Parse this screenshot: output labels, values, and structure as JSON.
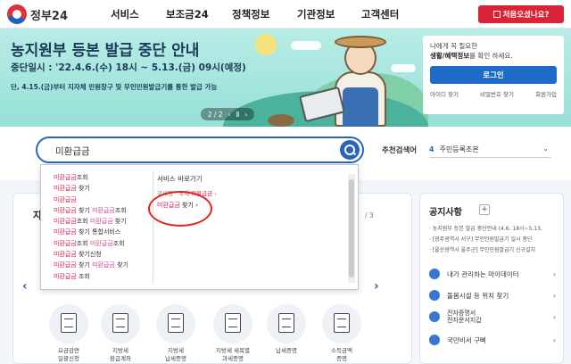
{
  "header": {
    "logo_text": "정부24",
    "nav": [
      "서비스",
      "보조금24",
      "정책정보",
      "기관정보",
      "고객센터"
    ],
    "cta_label": "처음오셨나요?",
    "colors": {
      "cta": "#d92336",
      "primary": "#2c64b6"
    }
  },
  "banner": {
    "title": "농지원부 등본 발급 중단 안내",
    "period": "중단일시 : '22.4.6.(수) 18시 ~ 5.13.(금) 09시(예정)",
    "note": "단, 4.15.(금)부터 지자체 민원창구 및 무인민원발급기를 통한 발급 가능",
    "pager": {
      "text": "2 / 2",
      "prev": "‹",
      "pause": "Ⅱ",
      "next": "›"
    }
  },
  "login": {
    "desc_line1": "나에게 꼭 필요한",
    "desc_line2_bold": "생활/혜택정보",
    "desc_line2_rest": "를 확인 하세요.",
    "button": "로그인",
    "links": [
      "아이디 찾기",
      "비밀번호 찾기",
      "회원가입"
    ]
  },
  "search": {
    "value": "미환급금",
    "recommend_label": "추천검색어",
    "recommend_num": "4",
    "recommend_term": "주민등록조본",
    "chevron": "⌄"
  },
  "autocomplete": {
    "items": [
      [
        {
          "t": "미환급금",
          "c": "red"
        },
        {
          "t": "조회",
          "c": ""
        }
      ],
      [
        {
          "t": "미환급금",
          "c": "red"
        },
        {
          "t": " 찾기",
          "c": ""
        }
      ],
      [
        {
          "t": "미환급금",
          "c": "red"
        }
      ],
      [
        {
          "t": "미환급금",
          "c": "red"
        },
        {
          "t": " 찾기 ",
          "c": ""
        },
        {
          "t": "미환급금",
          "c": "pink"
        },
        {
          "t": "조회",
          "c": ""
        }
      ],
      [
        {
          "t": "미환급금",
          "c": "red"
        },
        {
          "t": "조회 ",
          "c": ""
        },
        {
          "t": "미환급금",
          "c": "pink"
        },
        {
          "t": " 찾기",
          "c": ""
        }
      ],
      [
        {
          "t": "미환급금",
          "c": "red"
        },
        {
          "t": " 찾기 통합서비스",
          "c": ""
        }
      ],
      [
        {
          "t": "미환급금",
          "c": "red"
        },
        {
          "t": "조회 ",
          "c": ""
        },
        {
          "t": "미환급금",
          "c": "pink"
        },
        {
          "t": "조회",
          "c": ""
        }
      ],
      [
        {
          "t": "미환급금",
          "c": "red"
        },
        {
          "t": " 찾기신청",
          "c": ""
        }
      ],
      [
        {
          "t": "미환급금",
          "c": "red"
        },
        {
          "t": " 찾기 ",
          "c": ""
        },
        {
          "t": "미환급금",
          "c": "pink"
        },
        {
          "t": " 찾기",
          "c": ""
        }
      ],
      [
        {
          "t": "미환급금",
          "c": "red"
        },
        {
          "t": " 조회",
          "c": ""
        }
      ]
    ],
    "shortcut_title": "서비스 바로가기",
    "shortcut1_prefix": "국세청 · 국세",
    "shortcut1_red": "미환급금",
    "shortcut1_chev": "›",
    "shortcut2_red": "미환급금",
    "shortcut2_rest": " 찾기",
    "shortcut2_chev": "›"
  },
  "services": {
    "title": "자",
    "page": "/ 3",
    "prev": "‹",
    "next": "›",
    "tiles": [
      {
        "l1": "요금감면",
        "l2": "일괄신청"
      },
      {
        "l1": "지방세",
        "l2": "환급계좌"
      },
      {
        "l1": "지방세",
        "l2": "납세증명"
      },
      {
        "l1": "지방세 세목별",
        "l2": "과세증명"
      },
      {
        "l1": "납세증명",
        "l2": ""
      },
      {
        "l1": "소득금액",
        "l2": "증명"
      }
    ]
  },
  "notices": {
    "title": "공지사항",
    "plus": "+",
    "items": [
      "· 농지원부 등본 발급 중단안내 (4.6. 18시~5.13.",
      "· [광주광역시 서구] 무인민원발급기 일시 중단",
      "· [울산광역시 울주군] 무인민원발급기 신규설치"
    ]
  },
  "quick": {
    "chev": "›",
    "items": [
      {
        "label": "내가 관리하는 마이데이터"
      },
      {
        "label": "돌봄시설 등 위치 찾기"
      },
      {
        "line1": "전자증명서",
        "line2": "전자문서지갑"
      },
      {
        "label": "국민비서 구삐"
      }
    ]
  }
}
